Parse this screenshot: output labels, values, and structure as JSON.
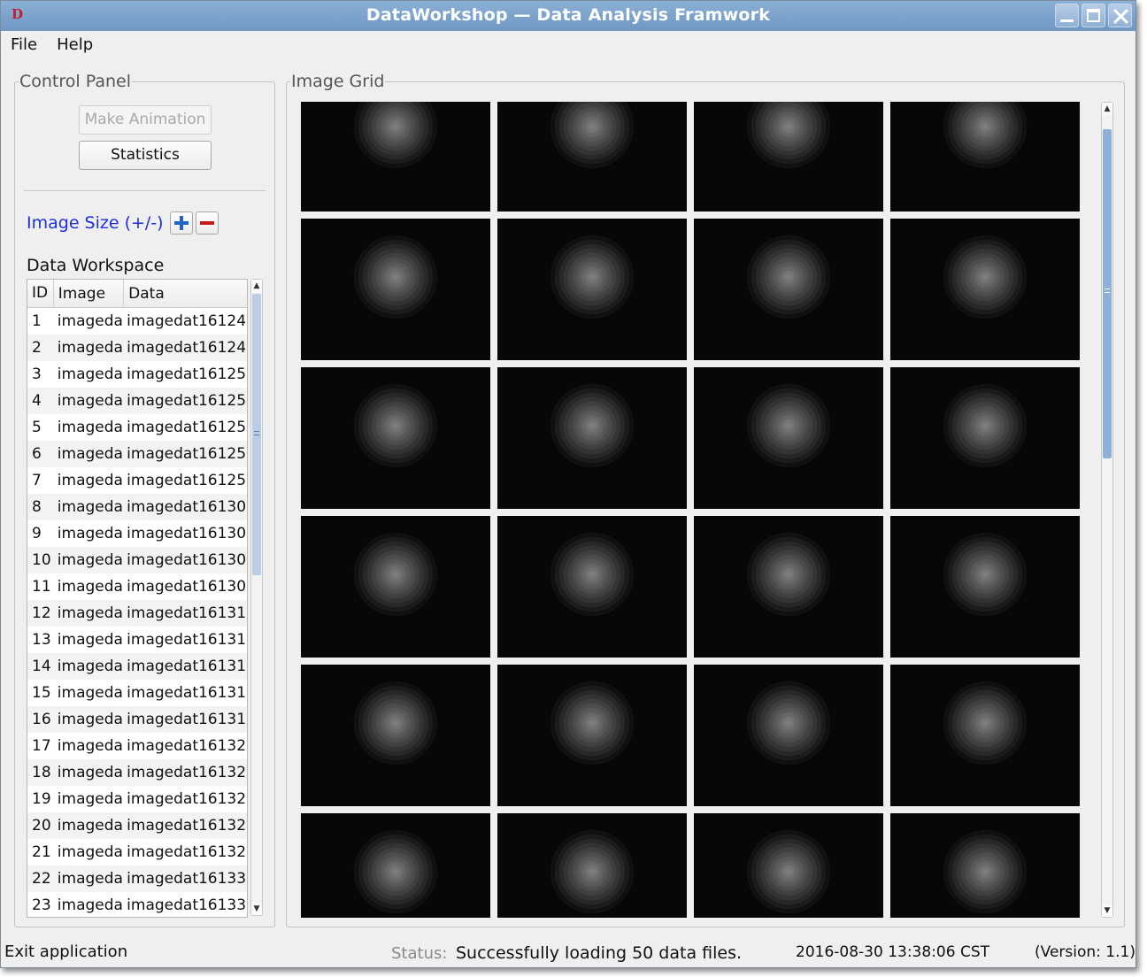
{
  "window": {
    "logo": "D",
    "title": "DataWorkshop — Data Analysis Framwork"
  },
  "menu": [
    "File",
    "Help"
  ],
  "control_panel": {
    "title": "Control Panel",
    "make_animation": "Make Animation",
    "statistics": "Statistics",
    "image_size_label": "Image Size (+/-)",
    "workspace_label": "Data Workspace",
    "columns": [
      "ID",
      "Image",
      "Data"
    ],
    "rows": [
      {
        "id": "1",
        "image": "imageda",
        "data": "imagedat16124"
      },
      {
        "id": "2",
        "image": "imageda",
        "data": "imagedat16124"
      },
      {
        "id": "3",
        "image": "imageda",
        "data": "imagedat16125"
      },
      {
        "id": "4",
        "image": "imageda",
        "data": "imagedat16125"
      },
      {
        "id": "5",
        "image": "imageda",
        "data": "imagedat16125"
      },
      {
        "id": "6",
        "image": "imageda",
        "data": "imagedat16125"
      },
      {
        "id": "7",
        "image": "imageda",
        "data": "imagedat16125"
      },
      {
        "id": "8",
        "image": "imageda",
        "data": "imagedat16130"
      },
      {
        "id": "9",
        "image": "imageda",
        "data": "imagedat16130"
      },
      {
        "id": "10",
        "image": "imageda",
        "data": "imagedat16130"
      },
      {
        "id": "11",
        "image": "imageda",
        "data": "imagedat16130"
      },
      {
        "id": "12",
        "image": "imageda",
        "data": "imagedat16131"
      },
      {
        "id": "13",
        "image": "imageda",
        "data": "imagedat16131"
      },
      {
        "id": "14",
        "image": "imageda",
        "data": "imagedat16131"
      },
      {
        "id": "15",
        "image": "imageda",
        "data": "imagedat16131"
      },
      {
        "id": "16",
        "image": "imageda",
        "data": "imagedat16131"
      },
      {
        "id": "17",
        "image": "imageda",
        "data": "imagedat16132"
      },
      {
        "id": "18",
        "image": "imageda",
        "data": "imagedat16132"
      },
      {
        "id": "19",
        "image": "imageda",
        "data": "imagedat16132"
      },
      {
        "id": "20",
        "image": "imageda",
        "data": "imagedat16132"
      },
      {
        "id": "21",
        "image": "imageda",
        "data": "imagedat16132"
      },
      {
        "id": "22",
        "image": "imageda",
        "data": "imagedat16133"
      },
      {
        "id": "23",
        "image": "imageda",
        "data": "imagedat16133"
      }
    ]
  },
  "image_grid": {
    "title": "Image Grid",
    "columns": 4,
    "visible_rows": 6
  },
  "status_bar": {
    "left": "Exit application",
    "label": "Status:",
    "message": "Successfully loading 50 data files.",
    "timestamp": "2016-08-30 13:38:06 CST",
    "version": "(Version: 1.1)"
  },
  "colors": {
    "titlebar": "#7aa1cc",
    "accent_blue": "#1b2fe0",
    "plus": "#1f64c8",
    "minus": "#c61a1a",
    "scroll_thumb": "#8fb0d6"
  },
  "icons": [
    "app-logo-icon",
    "minimize-icon",
    "maximize-icon",
    "close-icon",
    "plus-icon",
    "minus-icon",
    "scroll-up-icon",
    "scroll-down-icon"
  ]
}
